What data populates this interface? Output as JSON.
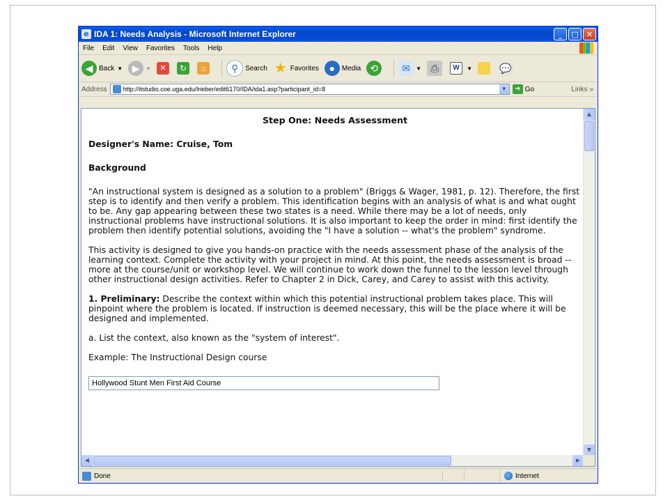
{
  "window": {
    "title": "IDA 1: Needs Analysis - Microsoft Internet Explorer"
  },
  "menu": [
    "File",
    "Edit",
    "View",
    "Favorites",
    "Tools",
    "Help"
  ],
  "toolbar": {
    "back": "Back",
    "search": "Search",
    "favorites": "Favorites",
    "media": "Media"
  },
  "address": {
    "label": "Address",
    "url": "http://itstudio.coe.uga.edu/lrieber/edit6170/IDA/ida1.asp?participant_id=8",
    "go": "Go",
    "links": "Links"
  },
  "content": {
    "step_title": "Step One: Needs Assessment",
    "designer": "Designer's Name: Cruise, Tom",
    "background_heading": "Background",
    "para1": "\"An instructional system is designed as a solution to a problem\" (Briggs & Wager, 1981, p. 12). Therefore, the first step is to identify and then verify a problem. This identification begins with an analysis of what is and what ought to be. Any gap appearing between these two states is a need. While there may be a lot of needs, only instructional problems have instructional solutions. It is also important to keep the order in mind: first identify the problem then identify potential solutions, avoiding the \"I have a solution -- what's the problem\" syndrome.",
    "para2": "This activity is designed to give you hands-on practice with the needs assessment phase of the analysis of the learning context. Complete the activity with your project in mind. At this point, the needs assessment is broad -- more at the course/unit or workshop level. We will continue to work down the funnel to the lesson level through other instructional design activities. Refer to Chapter 2 in Dick, Carey, and Carey to assist with this activity.",
    "prelim_label": "1. Preliminary:",
    "prelim_text": " Describe the context within which this potential instructional problem takes place. This will pinpoint where the problem is located. If instruction is deemed necessary, this will be the place where it will be designed and implemented.",
    "list_context": "a. List the context, also known as the \"system of interest\".",
    "example": "Example: The Instructional Design course",
    "context_input_value": "Hollywood Stunt Men First Aid Course"
  },
  "status": {
    "text": "Done",
    "zone": "Internet"
  }
}
